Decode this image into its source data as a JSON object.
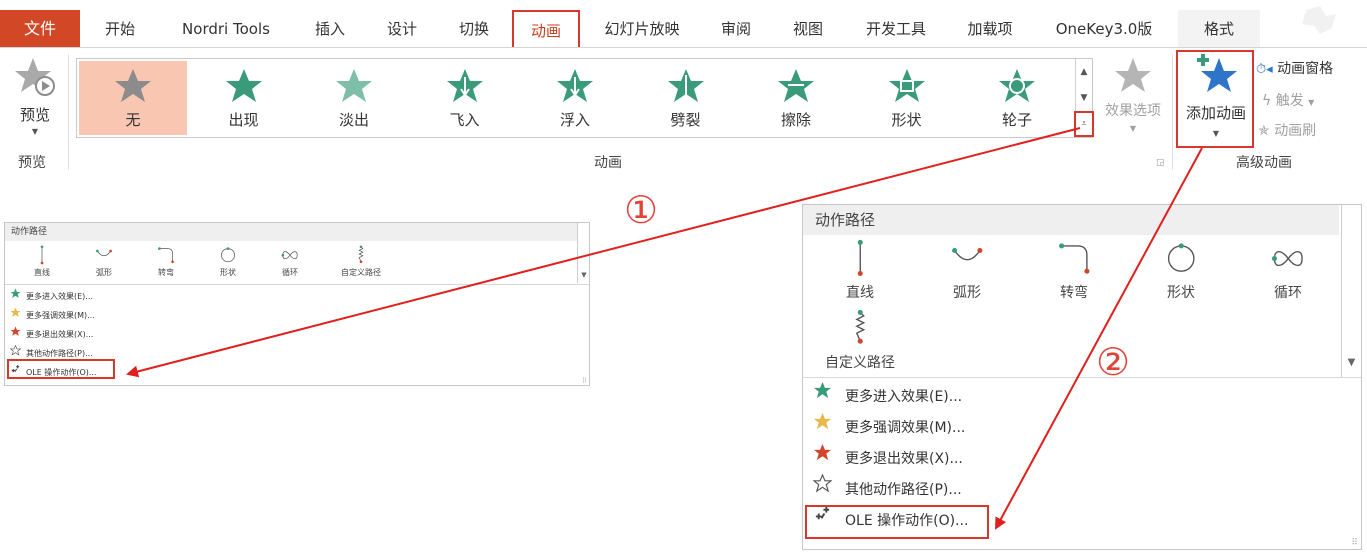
{
  "tabs": {
    "file": "文件",
    "home": "开始",
    "nordri": "Nordri Tools",
    "insert": "插入",
    "design": "设计",
    "transitions": "切换",
    "animations": "动画",
    "slideshow": "幻灯片放映",
    "review": "审阅",
    "view": "视图",
    "developer": "开发工具",
    "addins": "加载项",
    "onekey": "OneKey3.0版",
    "format": "格式"
  },
  "ribbon": {
    "preview_button": "预览",
    "preview_group": "预览",
    "gallery_items": [
      "无",
      "出现",
      "淡出",
      "飞入",
      "浮入",
      "劈裂",
      "擦除",
      "形状",
      "轮子"
    ],
    "animation_group": "动画",
    "effect_options": "效果选项",
    "add_animation": "添加动画",
    "animation_pane": "动画窗格",
    "trigger": "触发",
    "animation_painter": "动画刷",
    "advanced_group": "高级动画"
  },
  "panel_small": {
    "header": "动作路径",
    "paths": [
      "直线",
      "弧形",
      "转弯",
      "形状",
      "循环",
      "自定义路径"
    ],
    "menu": [
      {
        "text": "更多进入效果(E)...",
        "icon": "green-star-icon",
        "color": "#3a9b7a"
      },
      {
        "text": "更多强调效果(M)...",
        "icon": "gold-star-icon",
        "color": "#e8b84a"
      },
      {
        "text": "更多退出效果(X)...",
        "icon": "red-star-icon",
        "color": "#d2452b"
      },
      {
        "text": "其他动作路径(P)...",
        "icon": "outline-star-icon",
        "color": "#555555"
      },
      {
        "text": "OLE 操作动作(O)...",
        "icon": "ole-gear-icon",
        "color": "#555555"
      }
    ]
  },
  "panel_large": {
    "header": "动作路径",
    "paths": [
      "直线",
      "弧形",
      "转弯",
      "形状",
      "循环",
      "自定义路径"
    ],
    "menu": [
      {
        "text": "更多进入效果(E)...",
        "icon": "green-star-icon",
        "color": "#3a9b7a"
      },
      {
        "text": "更多强调效果(M)...",
        "icon": "gold-star-icon",
        "color": "#e8b84a"
      },
      {
        "text": "更多退出效果(X)...",
        "icon": "red-star-icon",
        "color": "#d2452b"
      },
      {
        "text": "其他动作路径(P)...",
        "icon": "outline-star-icon",
        "color": "#555555"
      },
      {
        "text": "OLE 操作动作(O)...",
        "icon": "ole-gear-icon",
        "color": "#555555"
      }
    ]
  },
  "annotations": {
    "step1": "①",
    "step2": "②"
  },
  "colors": {
    "accent": "#d24726",
    "highlight_border": "#d6392b",
    "selected_fill": "#f8c6b1",
    "arrow": "#e0201c",
    "star_teal": "#3a9b7a"
  }
}
